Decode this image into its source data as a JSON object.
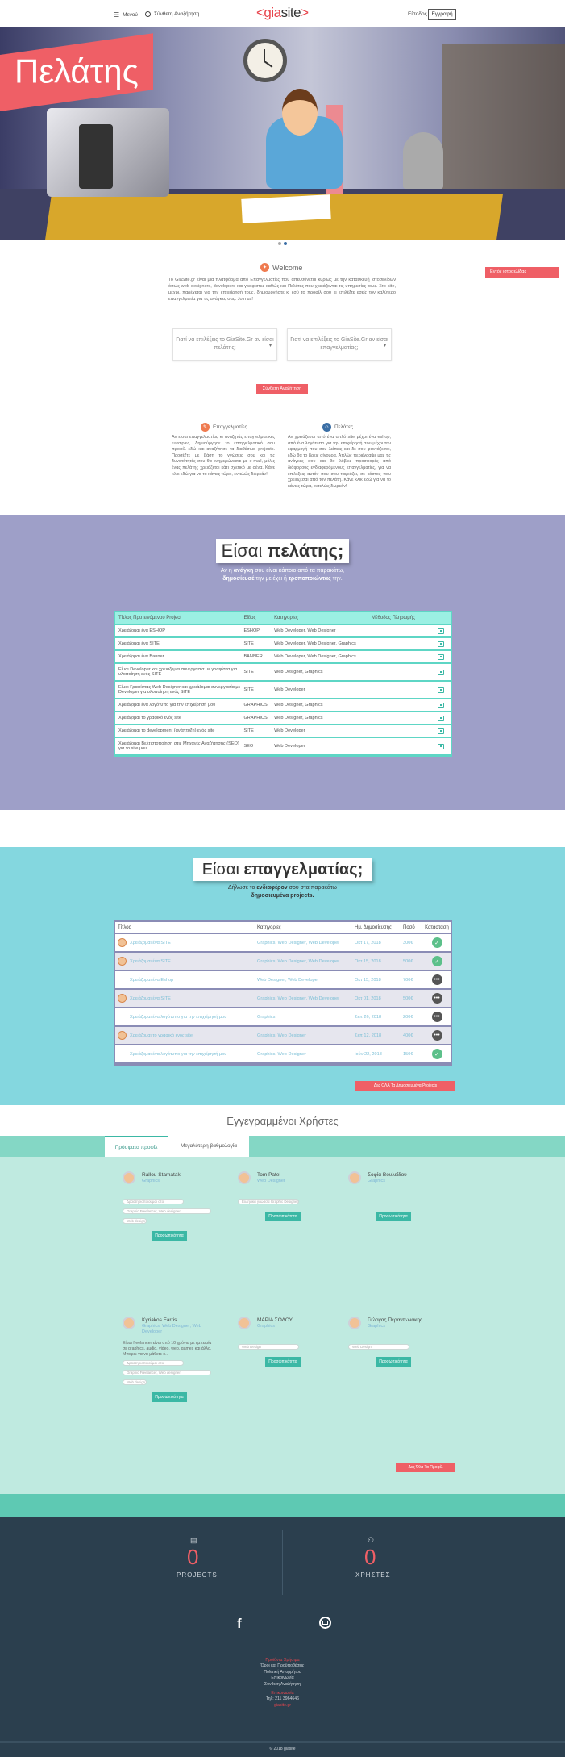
{
  "header": {
    "menu_label": "Μενού",
    "search_label": "Σύνθετη Αναζήτηση",
    "logo_open": "<gia",
    "logo_mid": "site",
    "logo_close": ">",
    "login_label": "Είσοδος",
    "register_label": "Εγγραφή"
  },
  "hero": {
    "badge": "Πελάτης"
  },
  "welcome": {
    "title": "Welcome",
    "intro": "Το GiaSite.gr είναι μια πλατφόρμα από Επαγγελματίες που απευθύνεται κυρίως με την κατασκευή ιστοσελίδων όπως web designers, developers και γραφίστες καθώς και Πελάτες που χρειάζονται τις υπηρεσίες τους. Στο site, μέχρι, παρέχεται για την επιχείρησή τους, δημιουργήστε κι εσύ το προφίλ σου κι επιλέξτε εσείς τον καλύτερο επαγγελματία για τις ανάγκες σας. Join us!",
    "aside_button": "Εντός ιστοσελίδας",
    "choice_client": "Γιατί να επιλέξεις το GiaSite.Gr αν είσαι πελάτης;",
    "choice_pro": "Γιατί να επιλέξεις το GiaSite.Gr αν είσαι επαγγελματίας;",
    "search_button": "Σύνθετη Αναζήτηση"
  },
  "columns": {
    "pro_title": "Επαγγελματίες",
    "pro_text": "Αν είσαι επαγγελματίας κι αναζητάς επαγγελματικές ευκαιρίες, δημιούργησε το επαγγελματικό σου προφίλ εδώ και αναζήτησε τα διαθέσιμα projects. Προσέξτε με βάση το γνώσεις σου και τις δυνατότητές σου θα ενημερώνεσαι με e-mail, μόλις ένας πελάτης χρειάζεται κάτι σχετικό με σένα. Κάνε κλικ εδώ για να το κάνεις τώρα, εντελώς δωρεάν!",
    "client_title": "Πελάτες",
    "client_text": "Αν χρειάζεσαι από ένα απλό site μέχρι ένα eshop, από ένα λογότυπο για την επιχείρησή σου μέχρι την εφαρμογή που σου λείπεις και δε σου φαντάζεσαι, εδώ θα το βρεις σίγουρα. Απλώς περιέγραψε μας τις ανάγκες σου και θα λάβεις προσφορές από διάφορους ενδιαφερόμενους επαγγελματίες, για να επιλέξεις αυτόν που σου ταιριάζει, σε κόστος που χρειάζεσαι από τον πελάτη. Κάνε κλικ εδώ για να το κάνεις τώρα, εντελώς δωρεάν!"
  },
  "client_section": {
    "title_pre": "Είσαι ",
    "title_bold": "πελάτης;",
    "line1_pre": "Αν η ",
    "line1_bold": "ανάγκη",
    "line1_post": " σου είναι κάποιο από τα παρακάτω,",
    "line2_bold1": "δημοσίευσέ",
    "line2_mid": " την με έχει ή ",
    "line2_bold2": "τροποποιώντας",
    "line2_post": " την.",
    "headers": [
      "Τίτλος Προτεινόμενου Project",
      "Είδος",
      "Κατηγορίες",
      "Μέθοδος Πληρωμής"
    ],
    "rows": [
      {
        "title": "Χρειάζομαι ένα ESHOP",
        "type": "ESHOP",
        "cats": "Web Developer, Web Designer"
      },
      {
        "title": "Χρειάζομαι ένα SITE",
        "type": "SITE",
        "cats": "Web Developer, Web Designer, Graphics"
      },
      {
        "title": "Χρειάζομαι ένα Banner",
        "type": "BANNER",
        "cats": "Web Developer, Web Designer, Graphics"
      },
      {
        "title": "Είμαι Developer και χρειάζομαι συνεργασία με γραφίστα για υλοποίηση ενός SITE",
        "type": "SITE",
        "cats": "Web Designer, Graphics"
      },
      {
        "title": "Είμαι Γραφίστας Web Designer και χρειάζομαι συνεργασία με Developer για υλοποίηση ενός SITE",
        "type": "SITE",
        "cats": "Web Developer"
      },
      {
        "title": "Χρειάζομαι ένα λογότυπο για την επιχείρησή μου",
        "type": "GRAPHICS",
        "cats": "Web Designer, Graphics"
      },
      {
        "title": "Χρειάζομαι το γραφικό ενός site",
        "type": "GRAPHICS",
        "cats": "Web Designer, Graphics"
      },
      {
        "title": "Χρειάζομαι το development (ανάπτυξη) ενός site",
        "type": "SITE",
        "cats": "Web Developer"
      },
      {
        "title": "Χρειάζομαι Βελτιστοποίηση στις Μηχανές Αναζήτησης (SEO) για το site μου",
        "type": "SEO",
        "cats": "Web Developer"
      }
    ]
  },
  "pro_section": {
    "title_pre": "Είσαι ",
    "title_bold": "επαγγελματίας;",
    "line1_pre": "Δήλωσε το ",
    "line1_bold": "ενδιαφέρον",
    "line1_post": " σου στα παρακάτω",
    "line2_bold": "δημοσιευμένα projects.",
    "headers": [
      "Τίτλος",
      "Κατηγορίες",
      "Ημ. Δημοσίευσης",
      "Ποσό",
      "Κατάσταση"
    ],
    "rows": [
      {
        "title": "Χρειάζομαι ένα SITE",
        "cats": "Graphics, Web Designer, Web Developer",
        "date": "Οκτ 17, 2018",
        "amount": "300€",
        "status": "check",
        "avatar": true,
        "alt": false
      },
      {
        "title": "Χρειάζομαι ένα SITE",
        "cats": "Graphics, Web Designer, Web Developer",
        "date": "Οκτ 15, 2018",
        "amount": "500€",
        "status": "check",
        "avatar": true,
        "alt": true
      },
      {
        "title": "Χρειάζομαι ένα Eshop",
        "cats": "Web Designer, Web Developer",
        "date": "Οκτ 15, 2018",
        "amount": "700€",
        "status": "more",
        "avatar": false,
        "alt": false
      },
      {
        "title": "Χρειάζομαι ένα SITE",
        "cats": "Graphics, Web Designer, Web Developer",
        "date": "Οκτ 01, 2018",
        "amount": "500€",
        "status": "more",
        "avatar": true,
        "alt": true
      },
      {
        "title": "Χρειάζομαι ένα λογότυπο για την επιχείρησή μου",
        "cats": "Graphics",
        "date": "Σεπ 26, 2018",
        "amount": "200€",
        "status": "more",
        "avatar": false,
        "alt": false
      },
      {
        "title": "Χρειάζομαι το γραφικό ενός site",
        "cats": "Graphics, Web Designer",
        "date": "Σεπ 12, 2018",
        "amount": "400€",
        "status": "more",
        "avatar": true,
        "alt": true
      },
      {
        "title": "Χρειάζομαι ένα λογότυπο για την επιχείρησή μου",
        "cats": "Graphics, Web Designer",
        "date": "Ιούν 22, 2018",
        "amount": "150€",
        "status": "check",
        "avatar": false,
        "alt": false
      }
    ],
    "all_button": "Δες ΟΛΑ Τα Δημοσιευμένα Projects"
  },
  "users_section": {
    "title": "Εγγεγραμμένοι Χρήστες",
    "tab_recent": "Πρόσφατα προφίλ",
    "tab_top": "Μεγαλύτερη βαθμολογία",
    "users": [
      {
        "name": "Rallou Stamataki",
        "role": "Graphics",
        "pills": [
          "Δραστηριοποιούμαι στο",
          "Graphic Freelancer, Web designer",
          "Web design"
        ],
        "button": "Προσωπικότητα"
      },
      {
        "name": "Tom Patel",
        "role": "Web Designer",
        "pills": [
          "Ελληνικά γλώσσα Graphic Designer"
        ],
        "button": "Προσωπικότητα"
      },
      {
        "name": "Σοφία Βουλείδου",
        "role": "Graphics",
        "pills": [],
        "button": "Προσωπικότητα"
      },
      {
        "name": "Kyriakos Farris",
        "role": "Graphics, Web Designer, Web Developer",
        "bio": "Είμαι freelancer είναι από 10 χρόνια με εμπειρία σε graphics, audio, video, web, games και άλλα. Μπορώ να να μάθετε ό...",
        "pills": [
          "Δραστηριοποιούμαι στο",
          "Graphic Freelancer, Web designer",
          "Web design"
        ],
        "button": "Προσωπικότητα"
      },
      {
        "name": "ΜΑΡΙΑ ΣΟΛΟΥ",
        "role": "Graphics",
        "pills": [
          "Web Design"
        ],
        "button": "Προσωπικότητα"
      },
      {
        "name": "Γιώργος Περαντωνάκης",
        "role": "Graphics",
        "pills": [
          "Web Design"
        ],
        "button": "Προσωπικότητα"
      }
    ],
    "all_users_button": "Δες Όλα Τα Προφίλ"
  },
  "footer": {
    "projects_count": "0",
    "projects_label": "PROJECTS",
    "users_count": "0",
    "users_label": "ΧΡΗΣΤΕΣ",
    "facebook": "f",
    "links_title": "Προϊόντα Χρήσιμα",
    "links": [
      "Όροι και Προϋποθέσεις",
      "Πολιτική Απορρήτου",
      "Επικοινωνία",
      "Σύνθετη Αναζήτηση"
    ],
    "contact_title": "Επικοινωνία",
    "phone": "Τηλ: 211 3964646",
    "email": "giasite.gr",
    "copyright": "© 2018 giasite"
  }
}
